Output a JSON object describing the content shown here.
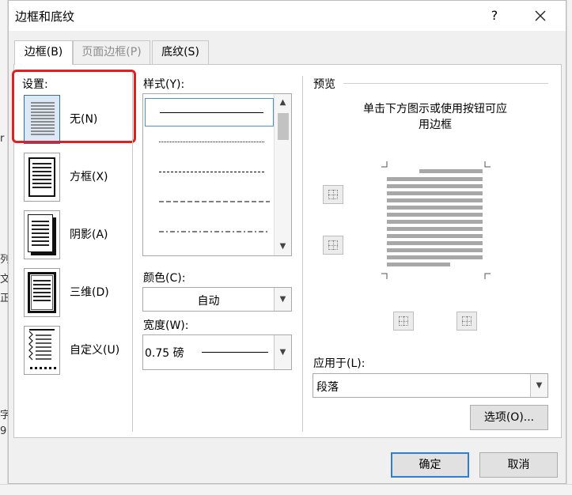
{
  "dialog": {
    "title": "边框和底纹",
    "help_label": "?",
    "close_icon": "close-icon"
  },
  "tabs": [
    {
      "label": "边框(B)",
      "active": true
    },
    {
      "label": "页面边框(P)",
      "active": false
    },
    {
      "label": "底纹(S)",
      "active": false
    }
  ],
  "settings": {
    "heading": "设置:",
    "items": [
      {
        "label": "无(N)",
        "icon": "page-none-icon",
        "selected": true
      },
      {
        "label": "方框(X)",
        "icon": "page-box-icon"
      },
      {
        "label": "阴影(A)",
        "icon": "page-shadow-icon"
      },
      {
        "label": "三维(D)",
        "icon": "page-3d-icon"
      },
      {
        "label": "自定义(U)",
        "icon": "page-custom-icon"
      }
    ]
  },
  "style": {
    "heading": "样式(Y):",
    "items": [
      "solid",
      "dotted",
      "dashed-small",
      "dashed",
      "dash-dot"
    ],
    "selected": "solid"
  },
  "color": {
    "heading": "颜色(C):",
    "value": "自动"
  },
  "width": {
    "heading": "宽度(W):",
    "value": "0.75 磅"
  },
  "preview": {
    "heading": "预览",
    "hint_line1": "单击下方图示或使用按钮可应",
    "hint_line2": "用边框"
  },
  "apply_to": {
    "heading": "应用于(L):",
    "value": "段落"
  },
  "buttons": {
    "options": "选项(O)...",
    "ok": "确定",
    "cancel": "取消"
  },
  "background_fragments": [
    "r",
    "列",
    "文",
    "正",
    "字",
    "9"
  ],
  "colors": {
    "highlight": "#e02020",
    "primary_border": "#2f7cd0"
  }
}
